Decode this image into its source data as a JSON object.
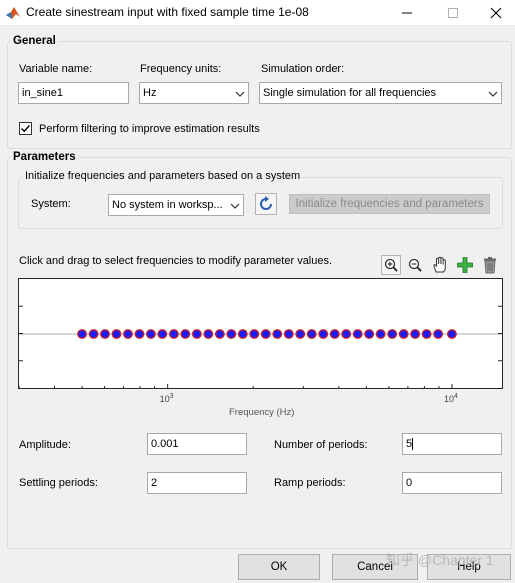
{
  "window": {
    "title": "Create sinestream input with fixed sample time 1e-08",
    "min_icon": "minimize-icon",
    "max_icon": "maximize-icon",
    "close_icon": "close-icon"
  },
  "general": {
    "group_label": "General",
    "variable_name_label": "Variable name:",
    "variable_name_value": "in_sine1",
    "frequency_units_label": "Frequency units:",
    "frequency_units_value": "Hz",
    "simulation_order_label": "Simulation order:",
    "simulation_order_value": "Single simulation for all frequencies",
    "filtering_checked": true,
    "filtering_label": "Perform filtering to improve estimation results"
  },
  "parameters": {
    "group_label": "Parameters",
    "init_group_label": "Initialize frequencies and parameters based on a system",
    "system_label": "System:",
    "system_value": "No system in worksp...",
    "init_button_label": "Initialize frequencies and parameters",
    "plot_hint": "Click and drag to select frequencies to modify parameter values.",
    "tools": [
      "zoom-in-icon",
      "zoom-out-icon",
      "pan-hand-icon",
      "add-icon",
      "delete-icon"
    ],
    "plot": {
      "xlabel": "Frequency (Hz)",
      "ticks": [
        {
          "base": "10",
          "exp": "3"
        },
        {
          "base": "10",
          "exp": "4"
        }
      ]
    },
    "amplitude_label": "Amplitude:",
    "amplitude_value": "0.001",
    "periods_label": "Number of periods:",
    "periods_value": "5",
    "settling_label": "Settling periods:",
    "settling_value": "2",
    "ramp_label": "Ramp periods:",
    "ramp_value": "0"
  },
  "chart_data": {
    "type": "scatter",
    "xlabel": "Frequency (Hz)",
    "xscale": "log",
    "xlim": [
      300,
      15000
    ],
    "x": [
      500,
      549,
      602,
      661,
      725,
      796,
      873,
      958,
      1052,
      1154,
      1267,
      1390,
      1526,
      1675,
      1838,
      2017,
      2214,
      2430,
      2667,
      2927,
      3212,
      3526,
      3870,
      4247,
      4661,
      5116,
      5615,
      6163,
      6764,
      7423,
      8147,
      8942,
      10000
    ],
    "marker_fill": "#1a1aff",
    "marker_edge": "#c0202a",
    "grid": false
  },
  "footer": {
    "ok_label": "OK",
    "cancel_label": "Cancel",
    "help_label": "Help"
  },
  "watermark": "知乎 @Chapter 1"
}
